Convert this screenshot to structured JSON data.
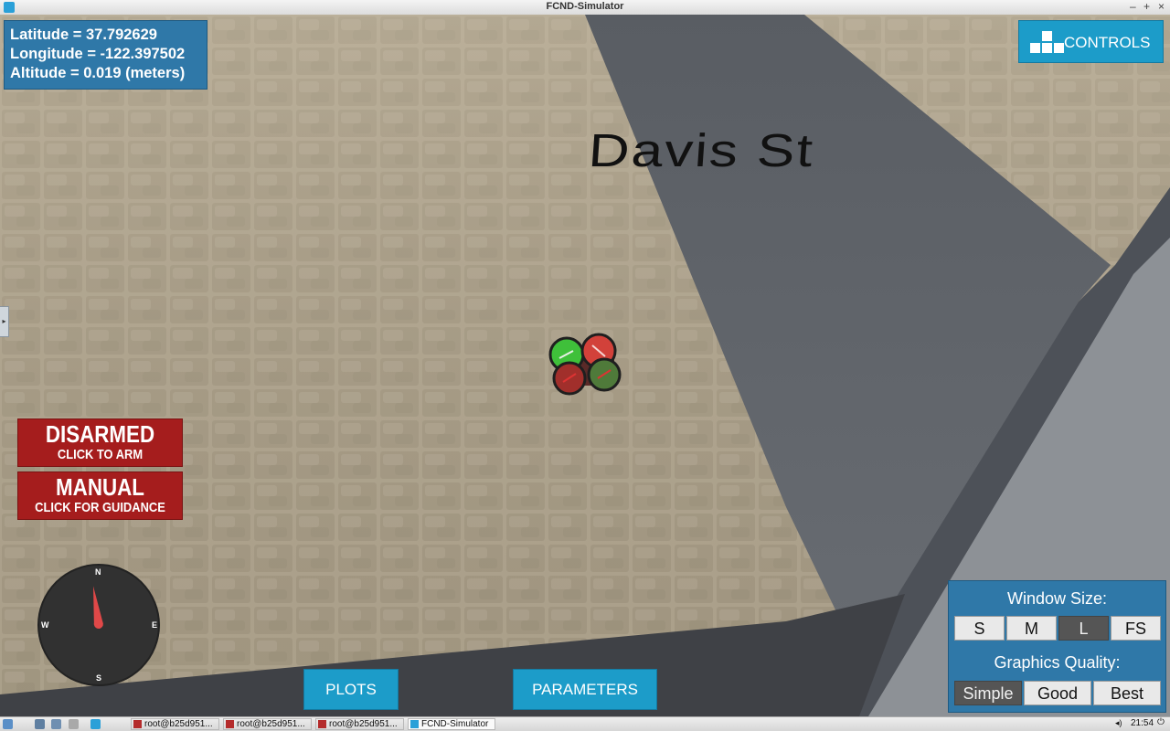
{
  "window": {
    "title": "FCND-Simulator",
    "controls": {
      "minimize": "–",
      "maximize": "+",
      "close": "×"
    }
  },
  "scene": {
    "street_name": "Davis St"
  },
  "coordinates": {
    "latitude": "Latitude = 37.792629",
    "longitude": "Longitude = -122.397502",
    "altitude": "Altitude = 0.019 (meters)"
  },
  "controls_button": {
    "label": "CONTROLS",
    "icon": "keyboard-keys-icon"
  },
  "arm_button": {
    "state": "DISARMED",
    "action": "CLICK TO ARM"
  },
  "mode_button": {
    "state": "MANUAL",
    "action": "CLICK FOR GUIDANCE"
  },
  "compass": {
    "n": "N",
    "e": "E",
    "s": "S",
    "w": "W",
    "heading_deg": 352
  },
  "bottom_buttons": {
    "plots": "PLOTS",
    "parameters": "PARAMETERS"
  },
  "window_size": {
    "title": "Window Size:",
    "options": [
      "S",
      "M",
      "L",
      "FS"
    ],
    "selected": "L"
  },
  "graphics_quality": {
    "title": "Graphics Quality:",
    "options": [
      "Simple",
      "Good",
      "Best"
    ],
    "selected": "Simple"
  },
  "taskbar": {
    "tasks": [
      "root@b25d951...",
      "root@b25d951...",
      "root@b25d951...",
      "FCND-Simulator"
    ],
    "active_task": "FCND-Simulator",
    "clock": "21:54"
  },
  "colors": {
    "panel_blue": "#2f78a8",
    "button_cyan": "#1c9cc9",
    "alert_red": "#a51d1d"
  }
}
